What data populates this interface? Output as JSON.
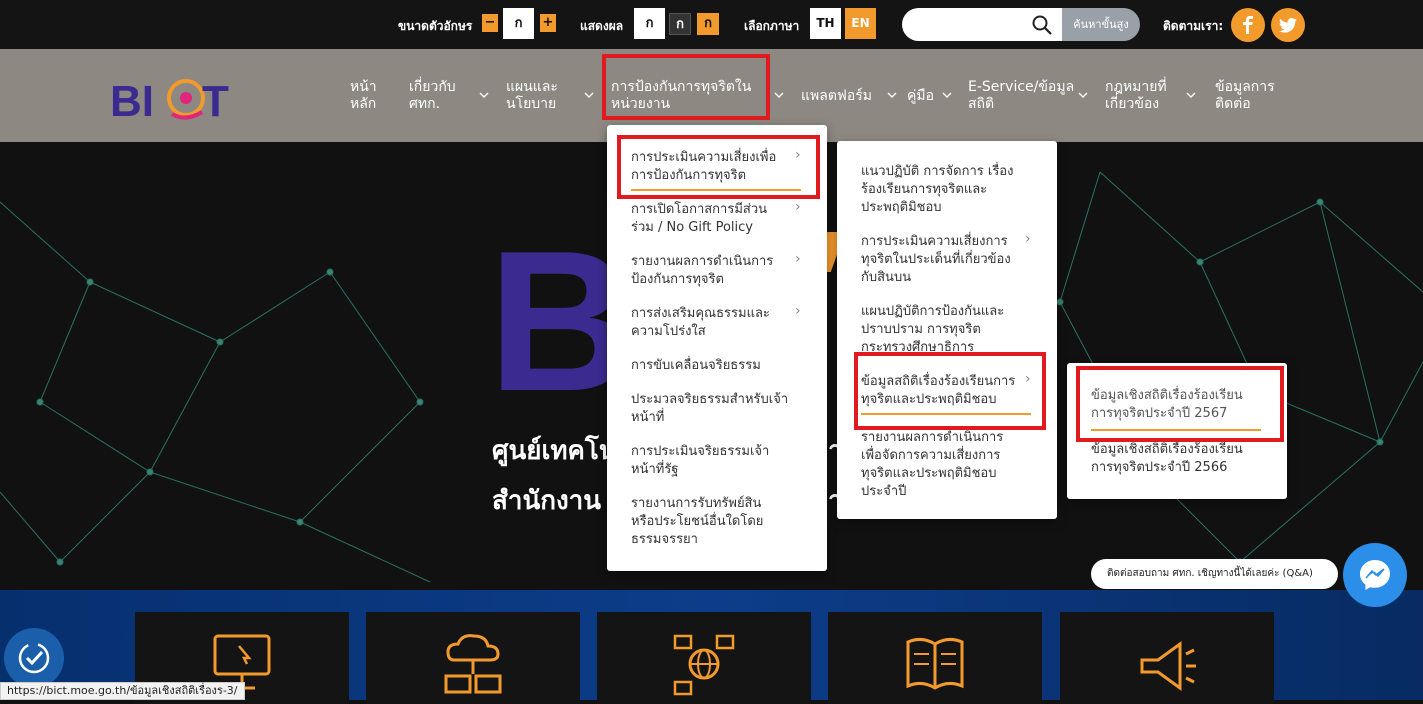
{
  "topbar": {
    "font_size_label": "ขนาดตัวอักษร",
    "font_minus": "−",
    "font_normal": "ก",
    "font_plus": "+",
    "display_label": "แสดงผล",
    "display_options": [
      "ก",
      "ก",
      "ก"
    ],
    "language_label": "เลือกภาษา",
    "lang_th": "TH",
    "lang_en": "EN",
    "search_placeholder": "",
    "advanced_search": "ค้นหาขั้นสูง",
    "follow_label": "ติดตามเรา:"
  },
  "logo_text": "BICT",
  "nav": {
    "items": [
      {
        "label": "หน้า\nหลัก"
      },
      {
        "label": "เกี่ยวกับ\nศทก."
      },
      {
        "label": "แผนและ\nนโยบาย"
      },
      {
        "label": "การป้องกันการทุจริตใน\nหน่วยงาน"
      },
      {
        "label": "แพลตฟอร์ม"
      },
      {
        "label": "คู่มือ"
      },
      {
        "label": "E-Service/ข้อมูล\nสถิติ"
      },
      {
        "label": "กฎหมายที่\nเกี่ยวข้อง"
      },
      {
        "label": "ข้อมูลการ\nติดต่อ"
      }
    ]
  },
  "hero": {
    "big_letter": "B",
    "line1": "ศูนย์เทคโน",
    "line1_end": "า",
    "line2": "สำนักงาน",
    "line2_end": "า"
  },
  "menu_level1": [
    "การประเมินความเสี่ยงเพื่อ\nการป้องกันการทุจริต",
    "การเปิดโอกาสการมีส่วน\nร่วม / No Gift Policy",
    "รายงานผลการดำเนินการ\nป้องกันการทุจริต",
    "การส่งเสริมคุณธรรมและ\nความโปร่งใส",
    "การขับเคลื่อนจริยธรรม",
    "ประมวลจริยธรรมสำหรับเจ้า\nหน้าที่",
    "การประเมินจริยธรรมเจ้า\nหน้าที่รัฐ",
    "รายงานการรับทรัพย์สิน\nหรือประโยชน์อื่นใดโดย\nธรรมจรรยา"
  ],
  "menu_level2": [
    "แนวปฏิบัติ การจัดการ เรื่อง\nร้องเรียนการทุจริตและ\nประพฤติมิชอบ",
    "การประเมินความเสี่ยงการ\nทุจริตในประเด็นที่เกี่ยวข้อง\nกับสินบน",
    "แผนปฏิบัติการป้องกันและ\nปราบปราม การทุจริต\nกระทรวงศึกษาธิการ",
    "ข้อมูลสถิติเรื่องร้องเรียนการ\nทุจริตและประพฤติมิชอบ",
    "รายงานผลการดำเนินการ\nเพื่อจัดการความเสี่ยงการ\nทุจริตและประพฤติมิชอบ\nประจำปี"
  ],
  "menu_level3": [
    "ข้อมูลเชิงสถิติเรื่องร้องเรียน\nการทุจริตประจำปี 2567",
    "ข้อมูลเชิงสถิติเรื่องร้องเรียน\nการทุจริตประจำปี 2566"
  ],
  "chat_text": "ติดต่อสอบถาม ศทก. เชิญทางนี้ได้เลยค่ะ (Q&A)",
  "status_url": "https://bict.moe.go.th/ข้อมูลเชิงสถิติเรื่องร-3/",
  "colors": {
    "accent": "#f39a2d",
    "highlight": "#e01a1f",
    "nav_bg": "#8d8881",
    "topbar_bg": "#141414"
  }
}
